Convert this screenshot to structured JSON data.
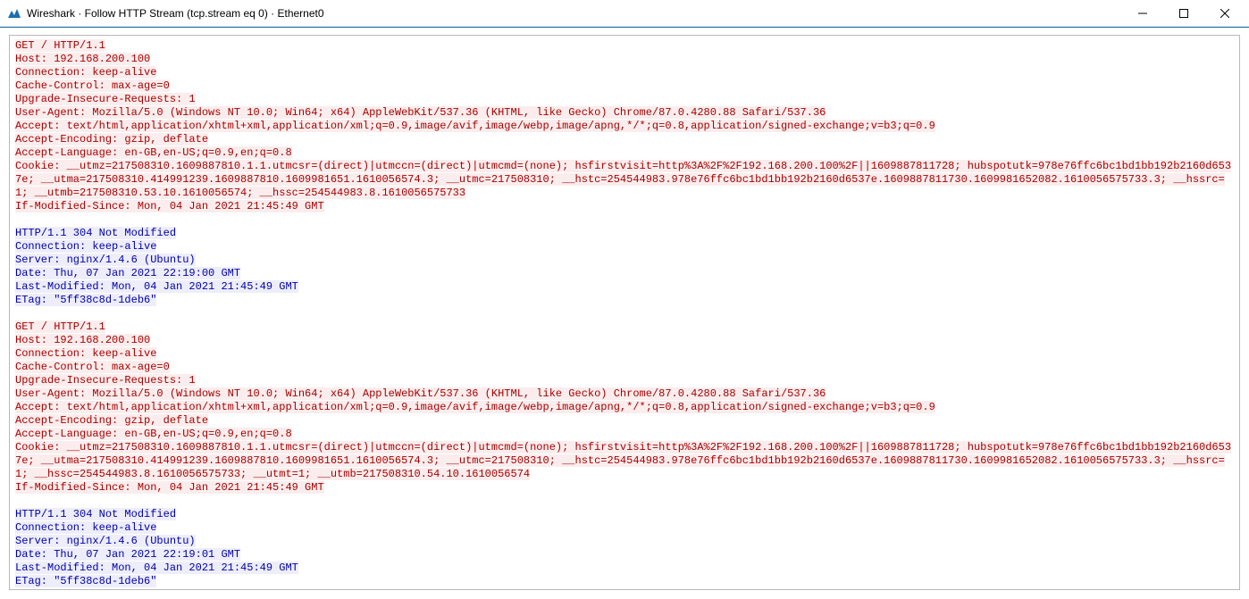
{
  "window": {
    "title": "Wireshark · Follow HTTP Stream (tcp.stream eq 0) · Ethernet0"
  },
  "stream": {
    "blocks": [
      {
        "type": "request",
        "text": "GET / HTTP/1.1\nHost: 192.168.200.100\nConnection: keep-alive\nCache-Control: max-age=0\nUpgrade-Insecure-Requests: 1\nUser-Agent: Mozilla/5.0 (Windows NT 10.0; Win64; x64) AppleWebKit/537.36 (KHTML, like Gecko) Chrome/87.0.4280.88 Safari/537.36\nAccept: text/html,application/xhtml+xml,application/xml;q=0.9,image/avif,image/webp,image/apng,*/*;q=0.8,application/signed-exchange;v=b3;q=0.9\nAccept-Encoding: gzip, deflate\nAccept-Language: en-GB,en-US;q=0.9,en;q=0.8\nCookie: __utmz=217508310.1609887810.1.1.utmcsr=(direct)|utmccn=(direct)|utmcmd=(none); hsfirstvisit=http%3A%2F%2F192.168.200.100%2F||1609887811728; hubspotutk=978e76ffc6bc1bd1bb192b2160d6537e; __utma=217508310.414991239.1609887810.1609981651.1610056574.3; __utmc=217508310; __hstc=254544983.978e76ffc6bc1bd1bb192b2160d6537e.1609887811730.1609981652082.1610056575733.3; __hssrc=1; __utmb=217508310.53.10.1610056574; __hssc=254544983.8.1610056575733\nIf-Modified-Since: Mon, 04 Jan 2021 21:45:49 GMT"
      },
      {
        "type": "blank",
        "text": ""
      },
      {
        "type": "response",
        "text": "HTTP/1.1 304 Not Modified\nConnection: keep-alive\nServer: nginx/1.4.6 (Ubuntu)\nDate: Thu, 07 Jan 2021 22:19:00 GMT\nLast-Modified: Mon, 04 Jan 2021 21:45:49 GMT\nETag: \"5ff38c8d-1deb6\""
      },
      {
        "type": "blank",
        "text": ""
      },
      {
        "type": "request",
        "text": "GET / HTTP/1.1\nHost: 192.168.200.100\nConnection: keep-alive\nCache-Control: max-age=0\nUpgrade-Insecure-Requests: 1\nUser-Agent: Mozilla/5.0 (Windows NT 10.0; Win64; x64) AppleWebKit/537.36 (KHTML, like Gecko) Chrome/87.0.4280.88 Safari/537.36\nAccept: text/html,application/xhtml+xml,application/xml;q=0.9,image/avif,image/webp,image/apng,*/*;q=0.8,application/signed-exchange;v=b3;q=0.9\nAccept-Encoding: gzip, deflate\nAccept-Language: en-GB,en-US;q=0.9,en;q=0.8\nCookie: __utmz=217508310.1609887810.1.1.utmcsr=(direct)|utmccn=(direct)|utmcmd=(none); hsfirstvisit=http%3A%2F%2F192.168.200.100%2F||1609887811728; hubspotutk=978e76ffc6bc1bd1bb192b2160d6537e; __utma=217508310.414991239.1609887810.1609981651.1610056574.3; __utmc=217508310; __hstc=254544983.978e76ffc6bc1bd1bb192b2160d6537e.1609887811730.1609981652082.1610056575733.3; __hssrc=1; __hssc=254544983.8.1610056575733; __utmt=1; __utmb=217508310.54.10.1610056574\nIf-Modified-Since: Mon, 04 Jan 2021 21:45:49 GMT"
      },
      {
        "type": "blank",
        "text": ""
      },
      {
        "type": "response",
        "text": "HTTP/1.1 304 Not Modified\nConnection: keep-alive\nServer: nginx/1.4.6 (Ubuntu)\nDate: Thu, 07 Jan 2021 22:19:01 GMT\nLast-Modified: Mon, 04 Jan 2021 21:45:49 GMT\nETag: \"5ff38c8d-1deb6\""
      }
    ]
  }
}
